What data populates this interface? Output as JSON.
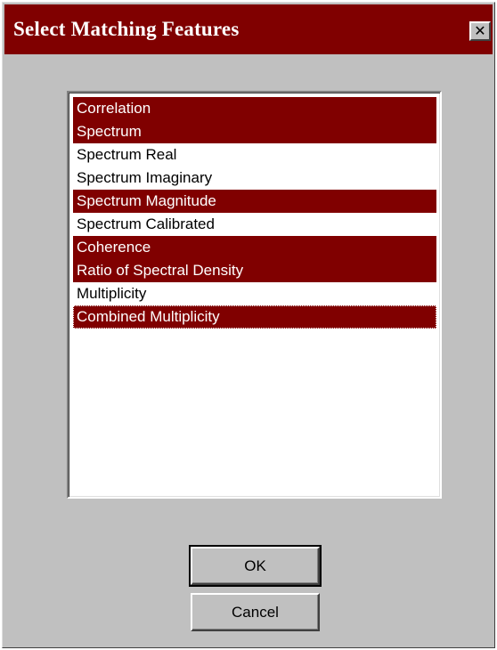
{
  "window": {
    "title": "Select Matching Features",
    "close_glyph": "✕",
    "title_color": "#800000",
    "face_color": "#c0c0c0"
  },
  "features": {
    "items": [
      {
        "label": "Correlation",
        "selected": true
      },
      {
        "label": "Spectrum",
        "selected": true
      },
      {
        "label": "Spectrum Real",
        "selected": false
      },
      {
        "label": "Spectrum Imaginary",
        "selected": false
      },
      {
        "label": "Spectrum Magnitude",
        "selected": true
      },
      {
        "label": "Spectrum Calibrated",
        "selected": false
      },
      {
        "label": "Coherence",
        "selected": true
      },
      {
        "label": "Ratio of Spectral Density",
        "selected": true
      },
      {
        "label": "Multiplicity",
        "selected": false
      },
      {
        "label": "Combined Multiplicity",
        "selected": true,
        "focused": true
      }
    ],
    "selection_color": "#800000"
  },
  "buttons": {
    "ok_label": "OK",
    "cancel_label": "Cancel"
  }
}
